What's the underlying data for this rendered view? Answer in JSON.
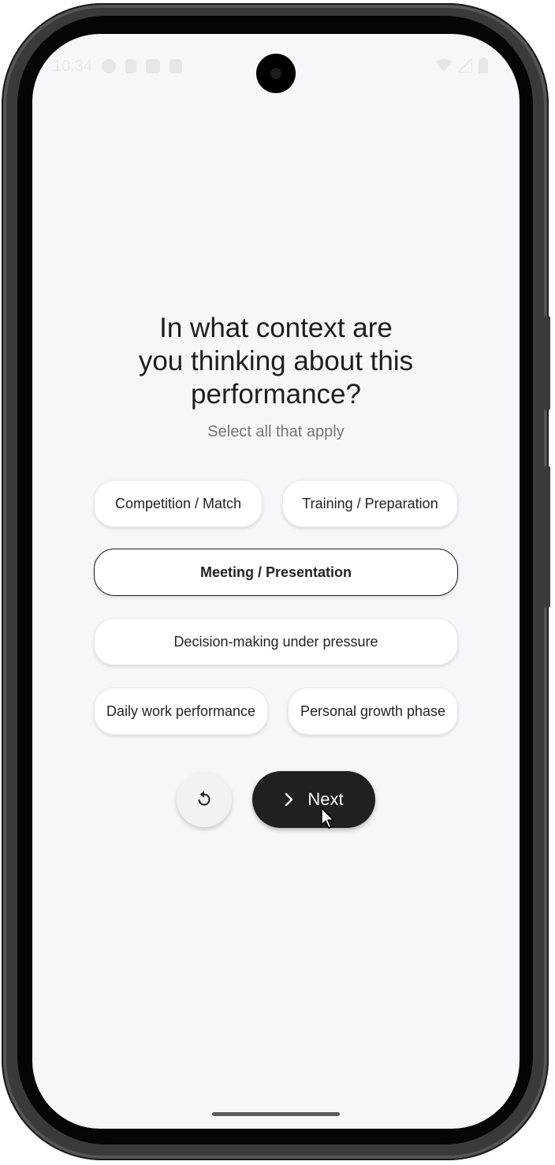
{
  "status_bar": {
    "time": "10:34"
  },
  "question": {
    "title_line1": "In what context are",
    "title_line2": "you thinking about this",
    "title_line3": "performance?",
    "subtitle": "Select all that apply"
  },
  "options": [
    {
      "label": "Competition / Match",
      "selected": false
    },
    {
      "label": "Training / Preparation",
      "selected": false
    },
    {
      "label": "Meeting / Presentation",
      "selected": true
    },
    {
      "label": "Decision-making under pressure",
      "selected": false
    },
    {
      "label": "Daily work performance",
      "selected": false
    },
    {
      "label": "Personal growth phase",
      "selected": false
    }
  ],
  "actions": {
    "reset_icon": "reset-icon",
    "next_label": "Next",
    "next_icon": "chevron-right-icon"
  },
  "colors": {
    "background": "#f7f7f9",
    "primary_button": "#202022",
    "chip_background": "#ffffff",
    "text_primary": "#1e1e20",
    "text_secondary": "#747478"
  }
}
